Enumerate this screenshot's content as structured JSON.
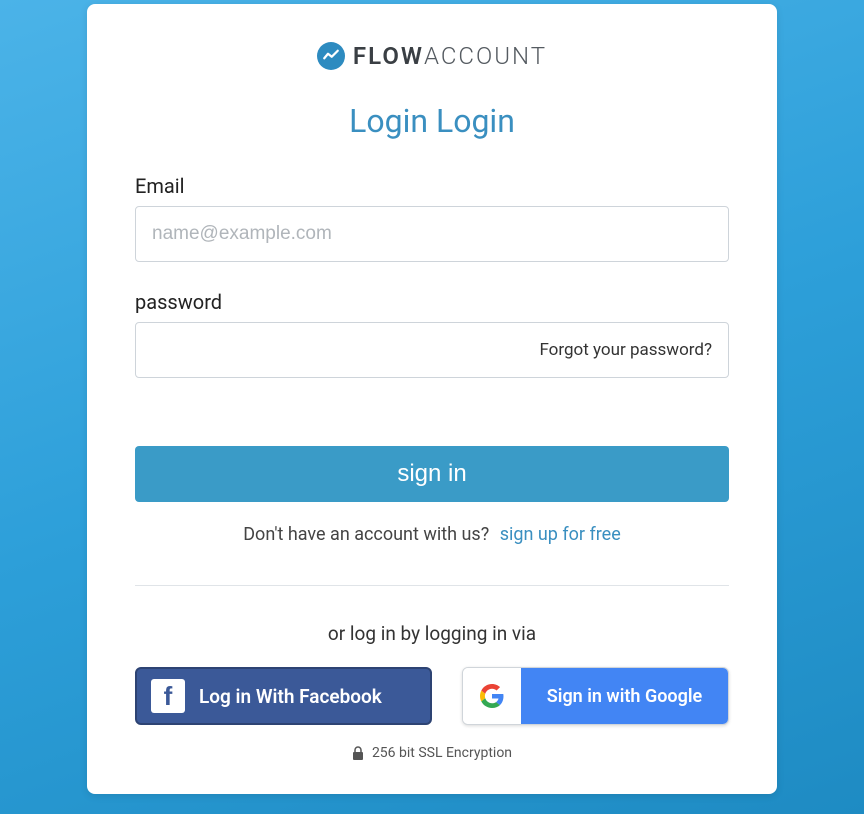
{
  "logo": {
    "bold": "FLOW",
    "light": "ACCOUNT"
  },
  "title": "Login Login",
  "form": {
    "email_label": "Email",
    "email_placeholder": "name@example.com",
    "password_label": "password",
    "forgot_link": "Forgot your password?",
    "submit": "sign in"
  },
  "signup": {
    "prompt": "Don't have an account with us?",
    "link": "sign up for free"
  },
  "social": {
    "label": "or log in by logging in via",
    "facebook": "Log in With Facebook",
    "google": "Sign in with Google"
  },
  "ssl": "256 bit SSL Encryption"
}
